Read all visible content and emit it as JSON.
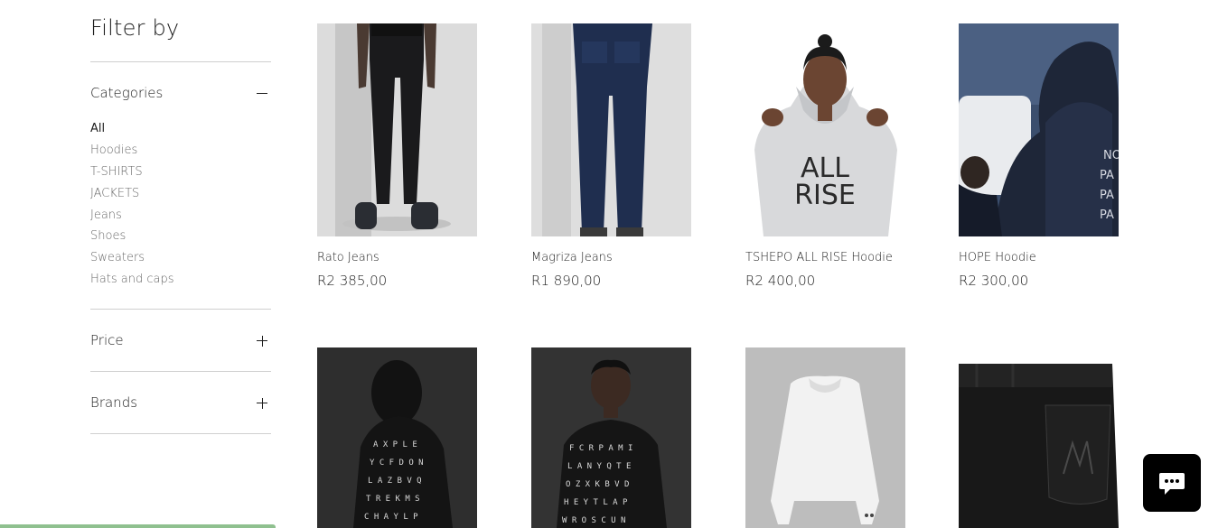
{
  "filter": {
    "title": "Filter by",
    "sections": {
      "categories": {
        "label": "Categories",
        "expanded": true
      },
      "price": {
        "label": "Price",
        "expanded": false
      },
      "brands": {
        "label": "Brands",
        "expanded": false
      }
    },
    "categories": [
      "All",
      "Hoodies",
      "T-SHIRTS",
      "JACKETS",
      "Jeans",
      "Shoes",
      "Sweaters",
      "Hats and caps"
    ],
    "selected_category": "All",
    "toggle_icons": {
      "expanded": "minus-icon",
      "collapsed": "plus-icon"
    }
  },
  "products": [
    {
      "name": "Rato Jeans",
      "price": "R2 385,00",
      "image": "black-jeans-photo"
    },
    {
      "name": "Magriza Jeans",
      "price": "R1 890,00",
      "image": "blue-jeans-photo"
    },
    {
      "name": "TSHEPO ALL RISE Hoodie",
      "price": "R2 400,00",
      "image": "grey-hoodie-photo"
    },
    {
      "name": "HOPE Hoodie",
      "price": "R2 300,00",
      "image": "navy-hoodie-photo"
    },
    {
      "name": "",
      "price": "",
      "image": "letter-print-shirt-back-photo"
    },
    {
      "name": "",
      "price": "",
      "image": "letter-print-shirt-front-photo"
    },
    {
      "name": "",
      "price": "",
      "image": "white-jacket-photo"
    },
    {
      "name": "",
      "price": "",
      "image": "leather-pants-photo"
    }
  ],
  "chat": {
    "icon": "chat-bubble-icon"
  },
  "colors": {
    "text": "#1c1c1c",
    "muted": "#666666",
    "divider": "#cfcfcf",
    "chat_bg": "#000000"
  }
}
